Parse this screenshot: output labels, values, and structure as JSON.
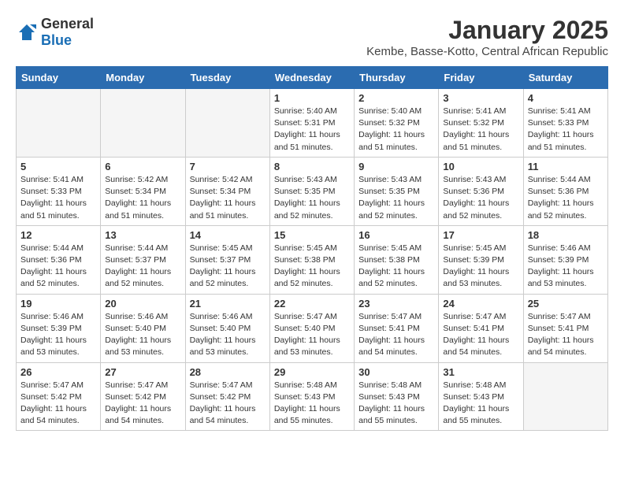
{
  "logo": {
    "general": "General",
    "blue": "Blue"
  },
  "title": "January 2025",
  "location": "Kembe, Basse-Kotto, Central African Republic",
  "days_of_week": [
    "Sunday",
    "Monday",
    "Tuesday",
    "Wednesday",
    "Thursday",
    "Friday",
    "Saturday"
  ],
  "weeks": [
    [
      {
        "day": "",
        "info": ""
      },
      {
        "day": "",
        "info": ""
      },
      {
        "day": "",
        "info": ""
      },
      {
        "day": "1",
        "info": "Sunrise: 5:40 AM\nSunset: 5:31 PM\nDaylight: 11 hours and 51 minutes."
      },
      {
        "day": "2",
        "info": "Sunrise: 5:40 AM\nSunset: 5:32 PM\nDaylight: 11 hours and 51 minutes."
      },
      {
        "day": "3",
        "info": "Sunrise: 5:41 AM\nSunset: 5:32 PM\nDaylight: 11 hours and 51 minutes."
      },
      {
        "day": "4",
        "info": "Sunrise: 5:41 AM\nSunset: 5:33 PM\nDaylight: 11 hours and 51 minutes."
      }
    ],
    [
      {
        "day": "5",
        "info": "Sunrise: 5:41 AM\nSunset: 5:33 PM\nDaylight: 11 hours and 51 minutes."
      },
      {
        "day": "6",
        "info": "Sunrise: 5:42 AM\nSunset: 5:34 PM\nDaylight: 11 hours and 51 minutes."
      },
      {
        "day": "7",
        "info": "Sunrise: 5:42 AM\nSunset: 5:34 PM\nDaylight: 11 hours and 51 minutes."
      },
      {
        "day": "8",
        "info": "Sunrise: 5:43 AM\nSunset: 5:35 PM\nDaylight: 11 hours and 52 minutes."
      },
      {
        "day": "9",
        "info": "Sunrise: 5:43 AM\nSunset: 5:35 PM\nDaylight: 11 hours and 52 minutes."
      },
      {
        "day": "10",
        "info": "Sunrise: 5:43 AM\nSunset: 5:36 PM\nDaylight: 11 hours and 52 minutes."
      },
      {
        "day": "11",
        "info": "Sunrise: 5:44 AM\nSunset: 5:36 PM\nDaylight: 11 hours and 52 minutes."
      }
    ],
    [
      {
        "day": "12",
        "info": "Sunrise: 5:44 AM\nSunset: 5:36 PM\nDaylight: 11 hours and 52 minutes."
      },
      {
        "day": "13",
        "info": "Sunrise: 5:44 AM\nSunset: 5:37 PM\nDaylight: 11 hours and 52 minutes."
      },
      {
        "day": "14",
        "info": "Sunrise: 5:45 AM\nSunset: 5:37 PM\nDaylight: 11 hours and 52 minutes."
      },
      {
        "day": "15",
        "info": "Sunrise: 5:45 AM\nSunset: 5:38 PM\nDaylight: 11 hours and 52 minutes."
      },
      {
        "day": "16",
        "info": "Sunrise: 5:45 AM\nSunset: 5:38 PM\nDaylight: 11 hours and 52 minutes."
      },
      {
        "day": "17",
        "info": "Sunrise: 5:45 AM\nSunset: 5:39 PM\nDaylight: 11 hours and 53 minutes."
      },
      {
        "day": "18",
        "info": "Sunrise: 5:46 AM\nSunset: 5:39 PM\nDaylight: 11 hours and 53 minutes."
      }
    ],
    [
      {
        "day": "19",
        "info": "Sunrise: 5:46 AM\nSunset: 5:39 PM\nDaylight: 11 hours and 53 minutes."
      },
      {
        "day": "20",
        "info": "Sunrise: 5:46 AM\nSunset: 5:40 PM\nDaylight: 11 hours and 53 minutes."
      },
      {
        "day": "21",
        "info": "Sunrise: 5:46 AM\nSunset: 5:40 PM\nDaylight: 11 hours and 53 minutes."
      },
      {
        "day": "22",
        "info": "Sunrise: 5:47 AM\nSunset: 5:40 PM\nDaylight: 11 hours and 53 minutes."
      },
      {
        "day": "23",
        "info": "Sunrise: 5:47 AM\nSunset: 5:41 PM\nDaylight: 11 hours and 54 minutes."
      },
      {
        "day": "24",
        "info": "Sunrise: 5:47 AM\nSunset: 5:41 PM\nDaylight: 11 hours and 54 minutes."
      },
      {
        "day": "25",
        "info": "Sunrise: 5:47 AM\nSunset: 5:41 PM\nDaylight: 11 hours and 54 minutes."
      }
    ],
    [
      {
        "day": "26",
        "info": "Sunrise: 5:47 AM\nSunset: 5:42 PM\nDaylight: 11 hours and 54 minutes."
      },
      {
        "day": "27",
        "info": "Sunrise: 5:47 AM\nSunset: 5:42 PM\nDaylight: 11 hours and 54 minutes."
      },
      {
        "day": "28",
        "info": "Sunrise: 5:47 AM\nSunset: 5:42 PM\nDaylight: 11 hours and 54 minutes."
      },
      {
        "day": "29",
        "info": "Sunrise: 5:48 AM\nSunset: 5:43 PM\nDaylight: 11 hours and 55 minutes."
      },
      {
        "day": "30",
        "info": "Sunrise: 5:48 AM\nSunset: 5:43 PM\nDaylight: 11 hours and 55 minutes."
      },
      {
        "day": "31",
        "info": "Sunrise: 5:48 AM\nSunset: 5:43 PM\nDaylight: 11 hours and 55 minutes."
      },
      {
        "day": "",
        "info": ""
      }
    ]
  ]
}
